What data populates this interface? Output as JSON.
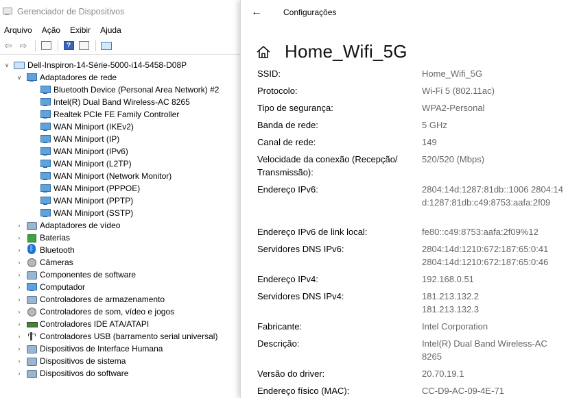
{
  "device_manager": {
    "title": "Gerenciador de Dispositivos",
    "menu": [
      "Arquivo",
      "Ação",
      "Exibir",
      "Ajuda"
    ],
    "toolbar_icons": [
      "back-arrow-icon",
      "forward-arrow-icon",
      "properties-icon",
      "help-icon",
      "view-icon",
      "monitor-icon"
    ],
    "root": "Dell-Inspiron-14-Série-5000-i14-5458-D08P",
    "expanded_category": "Adaptadores de rede",
    "network_adapters": [
      "Bluetooth Device (Personal Area Network) #2",
      "Intel(R) Dual Band Wireless-AC 8265",
      "Realtek PCIe FE Family Controller",
      "WAN Miniport (IKEv2)",
      "WAN Miniport (IP)",
      "WAN Miniport (IPv6)",
      "WAN Miniport (L2TP)",
      "WAN Miniport (Network Monitor)",
      "WAN Miniport (PPPOE)",
      "WAN Miniport (PPTP)",
      "WAN Miniport (SSTP)"
    ],
    "categories": [
      "Adaptadores de vídeo",
      "Baterias",
      "Bluetooth",
      "Câmeras",
      "Componentes de software",
      "Computador",
      "Controladores de armazenamento",
      "Controladores de som, vídeo e jogos",
      "Controladores IDE ATA/ATAPI",
      "Controladores USB (barramento serial universal)",
      "Dispositivos de Interface Humana",
      "Dispositivos de sistema",
      "Dispositivos do software"
    ]
  },
  "settings": {
    "title": "Configurações",
    "network_name": "Home_Wifi_5G",
    "properties": [
      {
        "label": "SSID:",
        "value": "Home_Wifi_5G"
      },
      {
        "label": "Protocolo:",
        "value": "Wi-Fi 5 (802.11ac)"
      },
      {
        "label": "Tipo de segurança:",
        "value": "WPA2-Personal"
      },
      {
        "label": "Banda de rede:",
        "value": "5 GHz"
      },
      {
        "label": "Canal de rede:",
        "value": "149"
      },
      {
        "label": "Velocidade da conexão (Recepção/ Transmissão):",
        "value": "520/520 (Mbps)"
      },
      {
        "label": "Endereço IPv6:",
        "value": "2804:14d:1287:81db::1006 2804:14d:1287:81db:c49:8753:aafa:2f09"
      },
      {
        "label": "Endereço IPv6 de link local:",
        "value": "fe80::c49:8753:aafa:2f09%12"
      },
      {
        "label": "Servidores DNS IPv6:",
        "value": "2804:14d:1210:672:187:65:0:41 2804:14d:1210:672:187:65:0:46"
      },
      {
        "label": "Endereço IPv4:",
        "value": "192.168.0.51"
      },
      {
        "label": "Servidores DNS IPv4:",
        "value": "181.213.132.2 181.213.132.3"
      },
      {
        "label": "Fabricante:",
        "value": "Intel Corporation"
      },
      {
        "label": "Descrição:",
        "value": "Intel(R) Dual Band Wireless-AC 8265"
      },
      {
        "label": "Versão do driver:",
        "value": "20.70.19.1"
      },
      {
        "label": "Endereço físico (MAC):",
        "value": "CC-D9-AC-09-4E-71"
      }
    ]
  }
}
